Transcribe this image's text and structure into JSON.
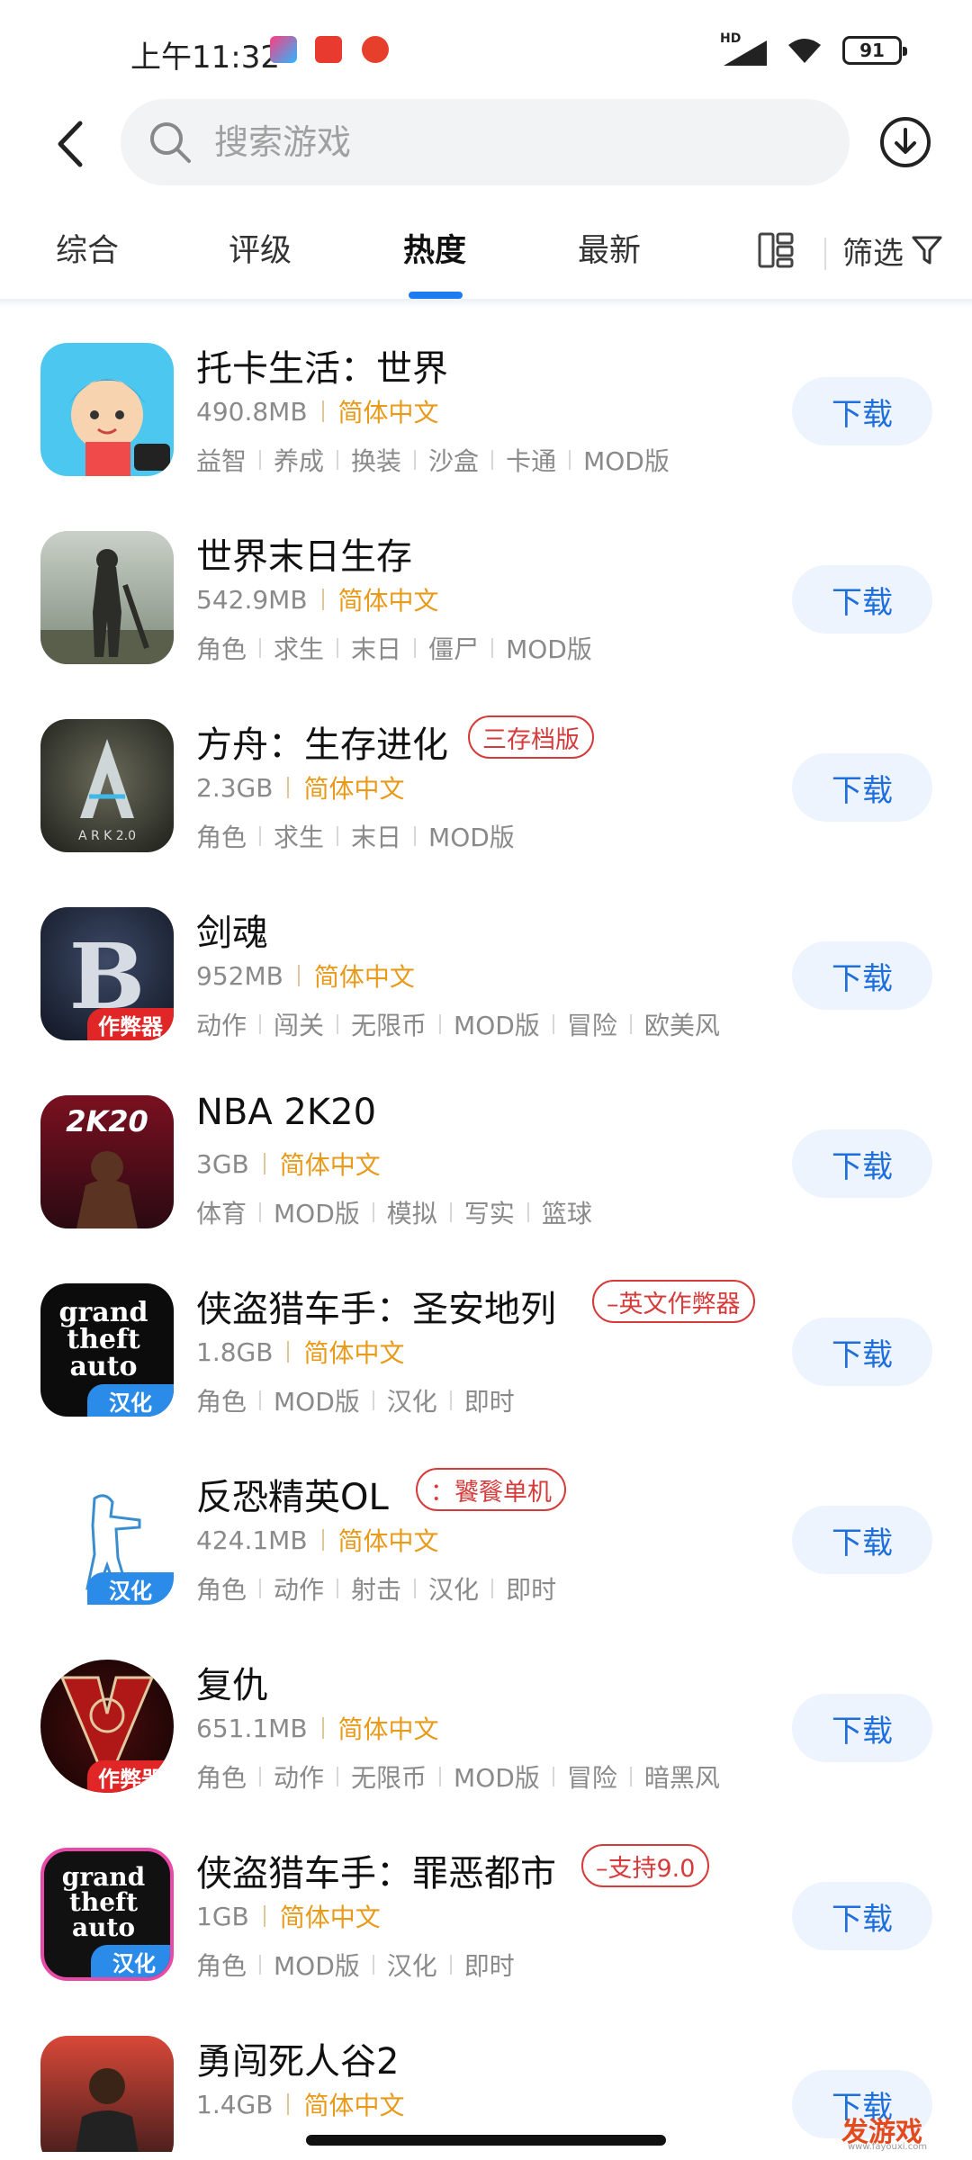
{
  "status_bar": {
    "time": "上午11:32",
    "battery": "91",
    "network": "HD"
  },
  "search": {
    "placeholder": "搜索游戏"
  },
  "tabs": [
    {
      "label": "综合",
      "active": false
    },
    {
      "label": "评级",
      "active": false
    },
    {
      "label": "热度",
      "active": true
    },
    {
      "label": "最新",
      "active": false
    }
  ],
  "filter_label": "筛选",
  "download_label": "下载",
  "accent_color": "#1e7cf3",
  "apps": [
    {
      "name": "托卡生活：世界",
      "size": "490.8MB",
      "lang": "简体中文",
      "tags": [
        "益智",
        "养成",
        "换装",
        "沙盒",
        "卡通",
        "MOD版"
      ],
      "badge": "",
      "name_tag": ""
    },
    {
      "name": "世界末日生存",
      "size": "542.9MB",
      "lang": "简体中文",
      "tags": [
        "角色",
        "求生",
        "末日",
        "僵尸",
        "MOD版"
      ],
      "badge": "",
      "name_tag": ""
    },
    {
      "name": "方舟：生存进化",
      "size": "2.3GB",
      "lang": "简体中文",
      "tags": [
        "角色",
        "求生",
        "末日",
        "MOD版"
      ],
      "badge": "",
      "name_tag": "三存档版"
    },
    {
      "name": "剑魂",
      "size": "952MB",
      "lang": "简体中文",
      "tags": [
        "动作",
        "闯关",
        "无限币",
        "MOD版",
        "冒险",
        "欧美风"
      ],
      "badge": "作弊器",
      "name_tag": ""
    },
    {
      "name": "NBA 2K20",
      "size": "3GB",
      "lang": "简体中文",
      "tags": [
        "体育",
        "MOD版",
        "模拟",
        "写实",
        "篮球"
      ],
      "badge": "",
      "name_tag": ""
    },
    {
      "name": "侠盗猎车手：圣安地列",
      "size": "1.8GB",
      "lang": "简体中文",
      "tags": [
        "角色",
        "MOD版",
        "汉化",
        "即时"
      ],
      "badge": "汉化",
      "name_tag": "–英文作弊器"
    },
    {
      "name": "反恐精英OL",
      "size": "424.1MB",
      "lang": "简体中文",
      "tags": [
        "角色",
        "动作",
        "射击",
        "汉化",
        "即时"
      ],
      "badge": "汉化",
      "name_tag": "：饕餮单机"
    },
    {
      "name": "复仇",
      "size": "651.1MB",
      "lang": "简体中文",
      "tags": [
        "角色",
        "动作",
        "无限币",
        "MOD版",
        "冒险",
        "暗黑风"
      ],
      "badge": "作弊器",
      "name_tag": ""
    },
    {
      "name": "侠盗猎车手：罪恶都市",
      "size": "1GB",
      "lang": "简体中文",
      "tags": [
        "角色",
        "MOD版",
        "汉化",
        "即时"
      ],
      "badge": "汉化",
      "name_tag": "–支持9.0"
    },
    {
      "name": "勇闯死人谷2",
      "size": "1.4GB",
      "lang": "简体中文",
      "tags": [],
      "badge": "",
      "name_tag": ""
    }
  ],
  "watermark": "发游戏",
  "watermark_url": "www.fayouxi.com"
}
